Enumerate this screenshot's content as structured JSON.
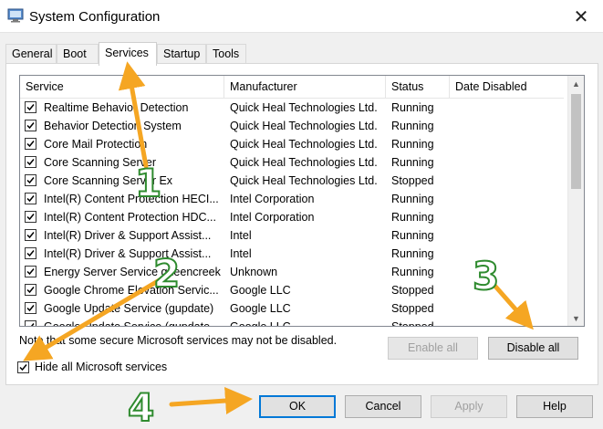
{
  "window": {
    "title": "System Configuration",
    "close_glyph": "✕",
    "icon": "system-config-icon"
  },
  "tabs": [
    {
      "label": "General",
      "active": false
    },
    {
      "label": "Boot",
      "active": false
    },
    {
      "label": "Services",
      "active": true
    },
    {
      "label": "Startup",
      "active": false
    },
    {
      "label": "Tools",
      "active": false
    }
  ],
  "services_table": {
    "columns": [
      "Service",
      "Manufacturer",
      "Status",
      "Date Disabled"
    ],
    "rows": [
      {
        "service": "Realtime Behavior Detection",
        "manufacturer": "Quick Heal Technologies Ltd.",
        "status": "Running",
        "date_disabled": "",
        "checked": true
      },
      {
        "service": "Behavior Detection System",
        "manufacturer": "Quick Heal Technologies Ltd.",
        "status": "Running",
        "date_disabled": "",
        "checked": true
      },
      {
        "service": "Core Mail Protection",
        "manufacturer": "Quick Heal Technologies Ltd.",
        "status": "Running",
        "date_disabled": "",
        "checked": true
      },
      {
        "service": "Core Scanning Server",
        "manufacturer": "Quick Heal Technologies Ltd.",
        "status": "Running",
        "date_disabled": "",
        "checked": true
      },
      {
        "service": "Core Scanning Server Ex",
        "manufacturer": "Quick Heal Technologies Ltd.",
        "status": "Stopped",
        "date_disabled": "",
        "checked": true
      },
      {
        "service": "Intel(R) Content Protection HECI...",
        "manufacturer": "Intel Corporation",
        "status": "Running",
        "date_disabled": "",
        "checked": true
      },
      {
        "service": "Intel(R) Content Protection HDC...",
        "manufacturer": "Intel Corporation",
        "status": "Running",
        "date_disabled": "",
        "checked": true
      },
      {
        "service": "Intel(R) Driver & Support Assist...",
        "manufacturer": "Intel",
        "status": "Running",
        "date_disabled": "",
        "checked": true
      },
      {
        "service": "Intel(R) Driver & Support Assist...",
        "manufacturer": "Intel",
        "status": "Running",
        "date_disabled": "",
        "checked": true
      },
      {
        "service": "Energy Server Service queencreek",
        "manufacturer": "Unknown",
        "status": "Running",
        "date_disabled": "",
        "checked": true
      },
      {
        "service": "Google Chrome Elevation Servic...",
        "manufacturer": "Google LLC",
        "status": "Stopped",
        "date_disabled": "",
        "checked": true
      },
      {
        "service": "Google Update Service (gupdate)",
        "manufacturer": "Google LLC",
        "status": "Stopped",
        "date_disabled": "",
        "checked": true
      },
      {
        "service": "Google Update Service (gupdate...",
        "manufacturer": "Google LLC",
        "status": "Stopped",
        "date_disabled": "",
        "checked": true
      }
    ]
  },
  "note": "Note that some secure Microsoft services may not be disabled.",
  "buttons": {
    "enable_all": "Enable all",
    "disable_all": "Disable all",
    "ok": "OK",
    "cancel": "Cancel",
    "apply": "Apply",
    "help": "Help"
  },
  "hide_microsoft": {
    "label": "Hide all Microsoft services",
    "checked": true
  },
  "annotations": {
    "numbers": [
      "1",
      "2",
      "3",
      "4"
    ],
    "arrow_color": "#f5a623",
    "number_color": "#2f8b2f"
  }
}
